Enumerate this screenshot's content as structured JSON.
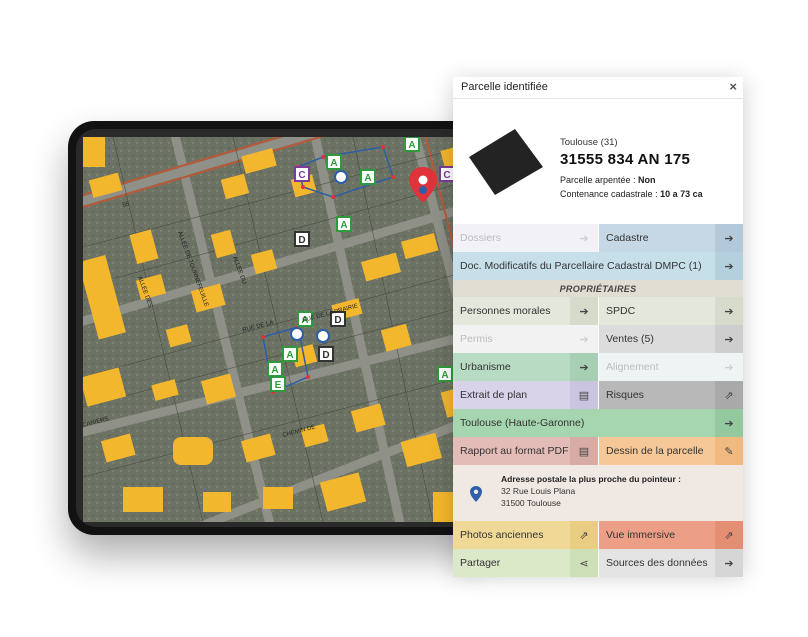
{
  "panel": {
    "title": "Parcelle identifiée",
    "close_icon": "×",
    "city": "Toulouse (31)",
    "parcel_id": "31555 834 AN 175",
    "surveyed_label": "Parcelle arpentée : ",
    "surveyed_value": "Non",
    "area_label": "Contenance cadastrale : ",
    "area_value": "10 a 73 ca"
  },
  "buttons": {
    "dossiers": "Dossiers",
    "cadastre": "Cadastre",
    "doc_modificatifs": "Doc. Modificatifs du Parcellaire Cadastral DMPC (1)",
    "proprietaires": "PROPRIÉTAIRES",
    "personnes_morales": "Personnes morales",
    "spdc": "SPDC",
    "permis": "Permis",
    "ventes": "Ventes (5)",
    "urbanisme": "Urbanisme",
    "alignement": "Alignement",
    "extrait_plan": "Extrait de plan",
    "risques": "Risques",
    "toulouse": "Toulouse (Haute-Garonne)",
    "rapport_pdf": "Rapport au format PDF",
    "dessin_parcelle": "Dessin de la parcelle",
    "photos_anciennes": "Photos anciennes",
    "vue_immersive": "Vue immersive",
    "partager": "Partager",
    "sources": "Sources des données"
  },
  "address": {
    "title": "Adresse postale la plus proche du pointeur :",
    "line1": "32 Rue Louis Plana",
    "line2": "31500 Toulouse"
  },
  "map": {
    "road_labels": [
      "55",
      "ALLÉE DE TOURNEFEUILLE",
      "ALLÉE DES",
      "RUE DE LA",
      "RUE DE LA PRAIRIE",
      "CANIERS",
      "ALLÉE DU",
      "CHEMIN DE"
    ],
    "marker_letters": [
      "A",
      "C",
      "D",
      "E"
    ]
  },
  "colors": {
    "dossiers": "#f1f1f6",
    "cadastre": "#c6d8e6",
    "doc_modificatifs": "#c7dfe9",
    "personnes_morales": "#e4e7db",
    "spdc": "#e4e7db",
    "permis": "#f2f2f2",
    "ventes": "#dcdcdc",
    "urbanisme": "#b8dcc3",
    "alignement": "#eef3f4",
    "extrait_plan": "#d8d3e9",
    "risques": "#b8b8b8",
    "toulouse": "#a5d6af",
    "rapport_pdf": "#e4bcb7",
    "dessin_parcelle": "#f6c897",
    "photos_anciennes": "#f0d997",
    "vue_immersive": "#ec9f86",
    "partager": "#dbe9c9",
    "sources": "#e4e4e4",
    "proprietaires_bar": "#e0ddd2",
    "address_box": "#f0e8e3",
    "parcel_shape": "#232323",
    "building_yellow": "#f3b72d",
    "road_red": "#b8593a",
    "pin_red": "#e0323a",
    "pin_blue": "#2d5ea8"
  },
  "icons": {
    "arrow": "arrow-right-icon",
    "pdf": "pdf-file-icon",
    "external": "external-link-icon",
    "pencil": "pencil-icon",
    "share": "share-icon",
    "pin": "map-pin-icon"
  }
}
